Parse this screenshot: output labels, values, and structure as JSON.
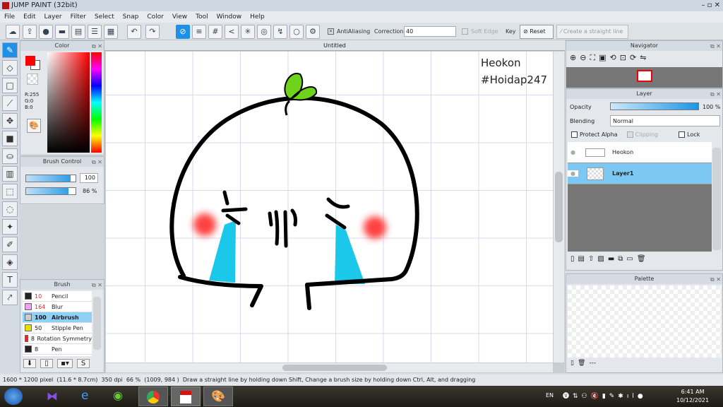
{
  "window": {
    "title": "JUMP PAINT (32bit)"
  },
  "menu": [
    "File",
    "Edit",
    "Layer",
    "Filter",
    "Select",
    "Snap",
    "Color",
    "View",
    "Tool",
    "Window",
    "Help"
  ],
  "toolbar": {
    "antialiasing": "AntiAliasing",
    "correction_label": "Correction",
    "correction_value": "40",
    "soft_edge": "Soft Edge",
    "key": "Key",
    "reset": "Reset",
    "straight_line": "Create a straight line"
  },
  "color_panel": {
    "title": "Color",
    "r": "R:255",
    "g": "G:0",
    "b": "B:0",
    "foreground": "#ff0000",
    "background": "#ffffff"
  },
  "brush_control": {
    "title": "Brush Control",
    "size": "100",
    "size_fraction": 1.0,
    "opacity": "86 %",
    "opacity_fraction": 0.86
  },
  "brush_panel": {
    "title": "Brush",
    "items": [
      {
        "size": "10",
        "name": "Pencil",
        "color": "#222222",
        "size_color": "#d03030"
      },
      {
        "size": "164",
        "name": "Blur",
        "color": "#f0a0f0",
        "size_color": "#d03030"
      },
      {
        "size": "100",
        "name": "Airbrush",
        "color": "#cccccc",
        "size_color": "#111111",
        "selected": true
      },
      {
        "size": "50",
        "name": "Stipple Pen",
        "color": "#e8e000",
        "size_color": "#111111"
      },
      {
        "size": "8",
        "name": "Rotation Symmetry",
        "color": "#ee2222",
        "size_color": "#111111"
      },
      {
        "size": "8",
        "name": "Pen",
        "color": "#222222",
        "size_color": "#111111"
      }
    ]
  },
  "document": {
    "tab": "Untitled",
    "text_line1": "Heokon",
    "text_line2": "#Hoidap247"
  },
  "navigator": {
    "title": "Navigator"
  },
  "layer_panel": {
    "title": "Layer",
    "opacity_label": "Opacity",
    "opacity_value": "100 %",
    "opacity_fraction": 1.0,
    "blending_label": "Blending",
    "blending_value": "Normal",
    "protect_alpha": "Protect Alpha",
    "clipping": "Clipping",
    "lock": "Lock",
    "layers": [
      {
        "name": "Heokon"
      },
      {
        "name": "Layer1",
        "selected": true
      }
    ]
  },
  "palette": {
    "title": "Palette",
    "footer": "---"
  },
  "status": {
    "size": "1600 * 1200 pixel",
    "cm": "(11.6 * 8.7cm)",
    "dpi": "350 dpi",
    "zoom": "66 %",
    "coords": "(1009, 984 )",
    "hint": "Draw a straight line by holding down Shift, Change a brush size by holding down Ctrl, Alt, and dragging"
  },
  "taskbar": {
    "lang": "EN",
    "time": "6:41 AM",
    "date": "10/12/2021"
  }
}
